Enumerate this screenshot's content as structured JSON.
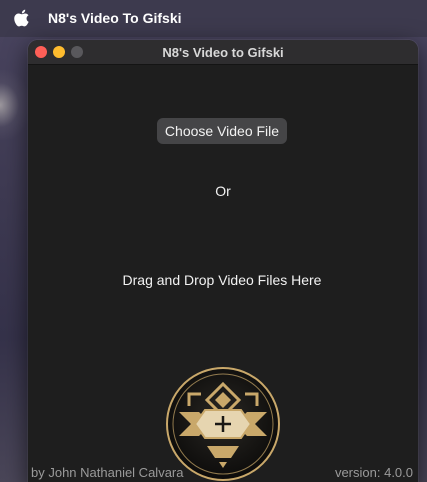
{
  "menubar": {
    "app_name": "N8's Video To Gifski",
    "apple_icon": "apple-logo-icon"
  },
  "window": {
    "title": "N8's Video to Gifski",
    "traffic_lights": {
      "close_color": "#fe5f57",
      "minimize_color": "#febc2e",
      "zoom_color": "#59585c"
    }
  },
  "main": {
    "choose_button_label": "Choose Video File",
    "or_label": "Or",
    "drop_label": "Drag and Drop Video Files Here",
    "logo_icon": "app-logo-emblem-icon"
  },
  "footer": {
    "credit": "by John Nathaniel Calvara",
    "version": "version: 4.0.0"
  },
  "colors": {
    "window_background": "#1e1e1e",
    "button_background": "#454547",
    "logo_gold": "#c9a86a"
  }
}
